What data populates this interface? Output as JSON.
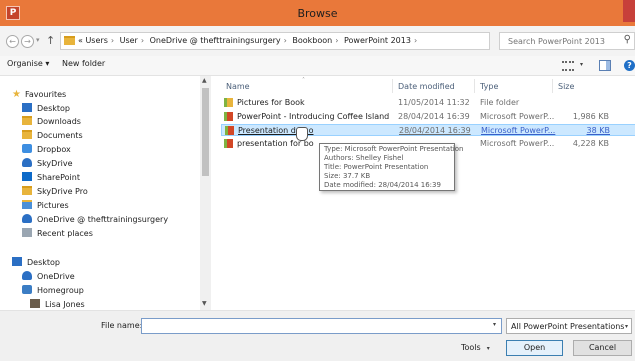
{
  "window": {
    "icon_letter": "P",
    "title": "Browse"
  },
  "address": {
    "crumbs": [
      "«",
      "Users",
      "User",
      "OneDrive @ thefttrainingsurgery",
      "Bookboon",
      "PowerPoint 2013"
    ],
    "search_placeholder": "Search PowerPoint 2013"
  },
  "toolbar": {
    "organise": "Organise ▾",
    "new_folder": "New folder"
  },
  "sidebar": {
    "favourites": "Favourites",
    "items": [
      {
        "label": "Desktop",
        "icon": "desktop-icon"
      },
      {
        "label": "Downloads",
        "icon": "folder-icon"
      },
      {
        "label": "Documents",
        "icon": "folder-icon"
      },
      {
        "label": "Dropbox",
        "icon": "dropbox-icon"
      },
      {
        "label": "SkyDrive",
        "icon": "cloud-icon"
      },
      {
        "label": "SharePoint",
        "icon": "sharepoint-icon"
      },
      {
        "label": "SkyDrive Pro",
        "icon": "folder-icon"
      },
      {
        "label": "Pictures",
        "icon": "pictures-icon"
      },
      {
        "label": "OneDrive @ thefttrainingsurgery",
        "icon": "cloud-icon"
      },
      {
        "label": "Recent places",
        "icon": "recent-places-icon"
      }
    ],
    "desktop_group": [
      {
        "label": "Desktop",
        "icon": "desktop-icon"
      },
      {
        "label": "OneDrive",
        "icon": "cloud-icon"
      },
      {
        "label": "Homegroup",
        "icon": "homegroup-icon"
      },
      {
        "label": "Lisa Jones",
        "icon": "user-icon"
      }
    ]
  },
  "columns": {
    "name": "Name",
    "date": "Date modified",
    "type": "Type",
    "size": "Size"
  },
  "files": [
    {
      "name": "Pictures for Book",
      "date": "11/05/2014 11:32",
      "type": "File folder",
      "size": ""
    },
    {
      "name": "PowerPoint - Introducing Coffee Island",
      "date": "28/04/2014 16:39",
      "type": "Microsoft PowerP...",
      "size": "1,986 KB"
    },
    {
      "name": "Presentation demo",
      "date": "28/04/2014 16:39",
      "type": "Microsoft PowerP...",
      "size": "38 KB"
    },
    {
      "name": "presentation for bo",
      "date": "",
      "type": "Microsoft PowerP...",
      "size": "4,228 KB"
    }
  ],
  "tooltip": {
    "type": "Type: Microsoft PowerPoint Presentation",
    "authors": "Authors: Shelley Fishel",
    "title": "Title: PowerPoint Presentation",
    "size": "Size: 37.7 KB",
    "date": "Date modified: 28/04/2014 16:39"
  },
  "footer": {
    "file_name_label": "File name:",
    "file_name_value": "",
    "filter": "All PowerPoint Presentations",
    "tools": "Tools",
    "open": "Open",
    "cancel": "Cancel"
  }
}
